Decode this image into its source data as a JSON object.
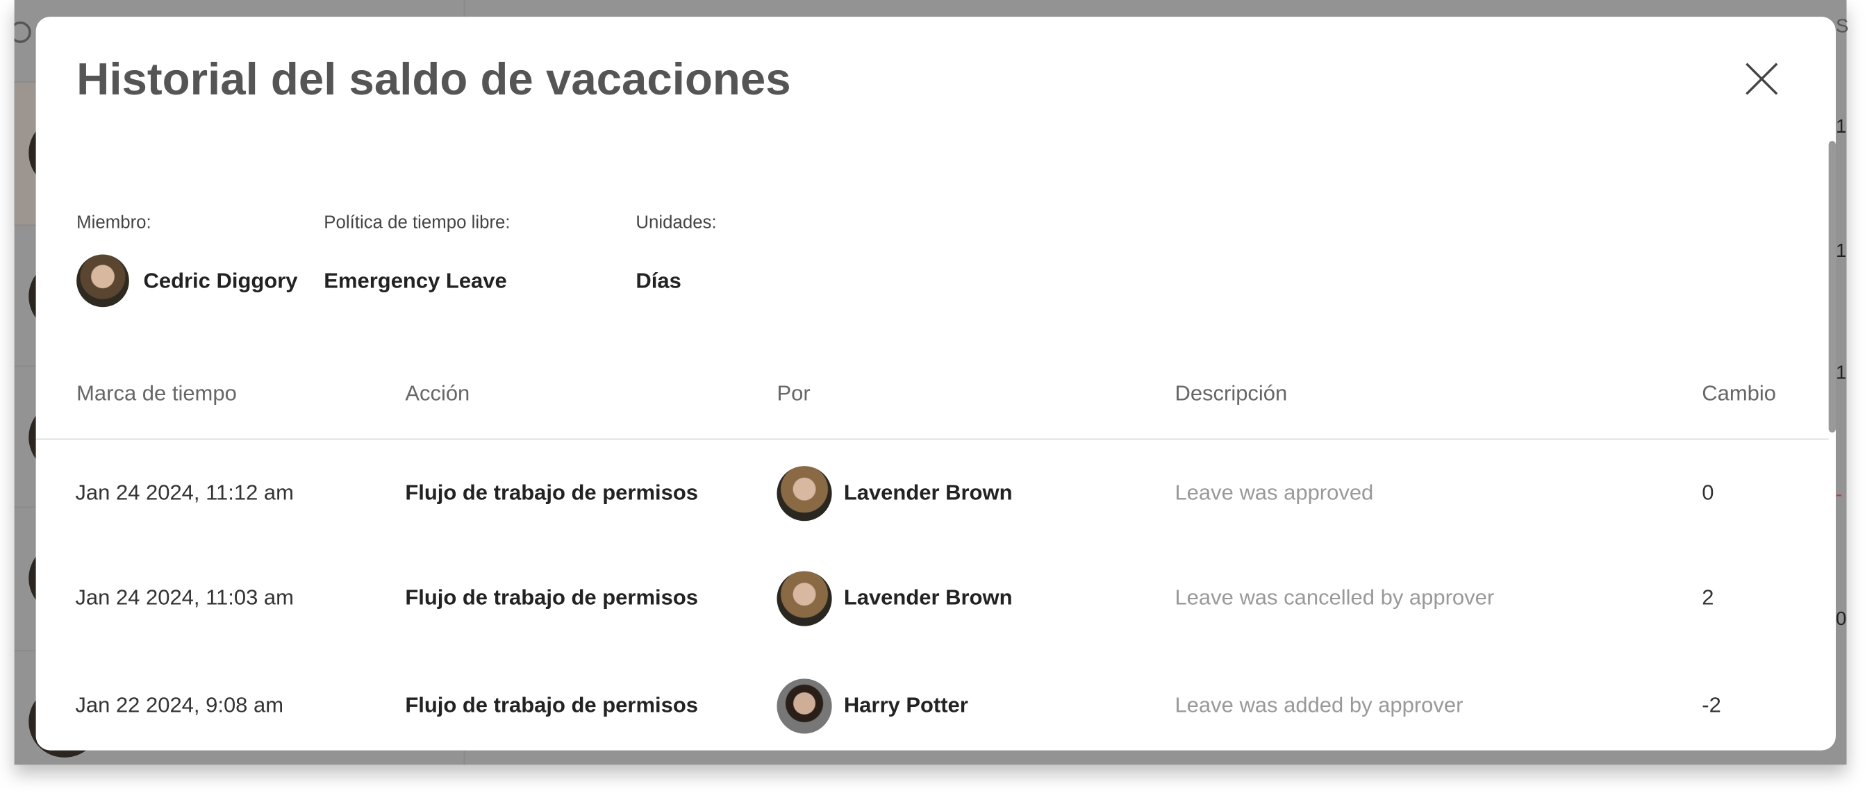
{
  "modal": {
    "title": "Historial del saldo de vacaciones",
    "close_icon": "close-icon",
    "member_label": "Miembro:",
    "member_name": "Cedric Diggory",
    "policy_label": "Política de tiempo libre:",
    "policy_value": "Emergency Leave",
    "units_label": "Unidades:",
    "units_value": "Días"
  },
  "table": {
    "headers": [
      "Marca de tiempo",
      "Acción",
      "Por",
      "Descripción",
      "Cambio"
    ],
    "rows": [
      {
        "timestamp": "Jan 24 2024, 11:12 am",
        "action": "Flujo de trabajo de permisos",
        "by": "Lavender Brown",
        "description": "Leave was approved",
        "change": "0"
      },
      {
        "timestamp": "Jan 24 2024, 11:03 am",
        "action": "Flujo de trabajo de permisos",
        "by": "Lavender Brown",
        "description": "Leave was cancelled by approver",
        "change": "2"
      },
      {
        "timestamp": "Jan 22 2024, 9:08 am",
        "action": "Flujo de trabajo de permisos",
        "by": "Harry Potter",
        "description": "Leave was added by approver",
        "change": "-2"
      }
    ]
  },
  "background": {
    "right_edge_chars": [
      "S",
      "1",
      "1",
      "1",
      "-",
      "0"
    ],
    "accent_negative": "#c0392b"
  }
}
